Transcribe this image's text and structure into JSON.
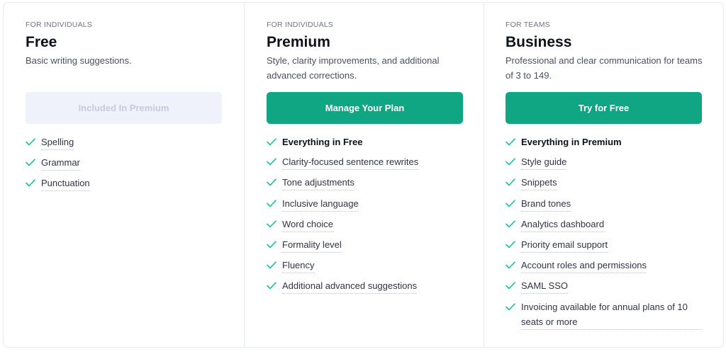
{
  "plans": [
    {
      "audience": "FOR INDIVIDUALS",
      "name": "Free",
      "description": "Basic writing suggestions.",
      "button": {
        "label": "Included In Premium",
        "state": "disabled"
      },
      "features": [
        {
          "label": "Spelling",
          "bold": false
        },
        {
          "label": "Grammar",
          "bold": false
        },
        {
          "label": "Punctuation",
          "bold": false
        }
      ]
    },
    {
      "audience": "FOR INDIVIDUALS",
      "name": "Premium",
      "description": "Style, clarity improvements, and additional advanced corrections.",
      "button": {
        "label": "Manage Your Plan",
        "state": "primary"
      },
      "features": [
        {
          "label": "Everything in Free",
          "bold": true
        },
        {
          "label": "Clarity-focused sentence rewrites",
          "bold": false
        },
        {
          "label": "Tone adjustments",
          "bold": false
        },
        {
          "label": "Inclusive language",
          "bold": false
        },
        {
          "label": "Word choice",
          "bold": false
        },
        {
          "label": "Formality level",
          "bold": false
        },
        {
          "label": "Fluency",
          "bold": false
        },
        {
          "label": "Additional advanced suggestions",
          "bold": false
        }
      ]
    },
    {
      "audience": "FOR TEAMS",
      "name": "Business",
      "description": "Professional and clear communication for teams of 3 to 149.",
      "button": {
        "label": "Try for Free",
        "state": "primary"
      },
      "features": [
        {
          "label": "Everything in Premium",
          "bold": true
        },
        {
          "label": "Style guide",
          "bold": false
        },
        {
          "label": "Snippets",
          "bold": false
        },
        {
          "label": "Brand tones",
          "bold": false
        },
        {
          "label": "Analytics dashboard",
          "bold": false
        },
        {
          "label": "Priority email support",
          "bold": false
        },
        {
          "label": "Account roles and permissions",
          "bold": false
        },
        {
          "label": "SAML SSO",
          "bold": false
        },
        {
          "label": "Invoicing available for annual plans of 10 seats or more",
          "bold": false
        }
      ]
    }
  ],
  "colors": {
    "accent": "#11a683",
    "check": "#15c39a",
    "disabled_bg": "#eff1fb",
    "disabled_text": "#c7cadd"
  },
  "icons": {
    "feature_check": "check-icon"
  }
}
